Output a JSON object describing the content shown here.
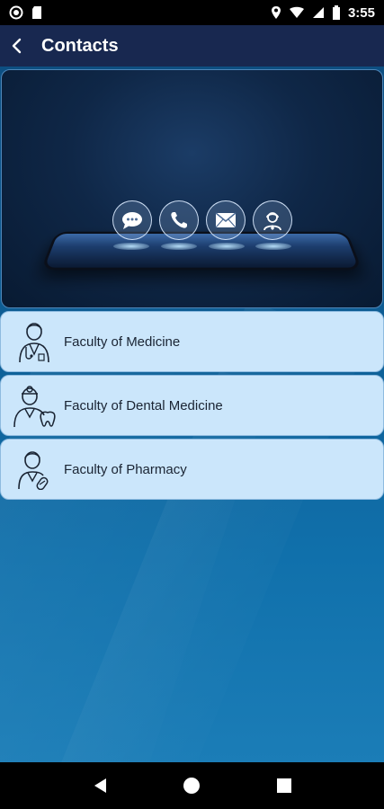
{
  "status_bar": {
    "time": "3:55",
    "icons": [
      "circle-notification-icon",
      "sd-card-icon",
      "location-icon",
      "wifi-icon",
      "signal-icon",
      "battery-icon"
    ]
  },
  "app_bar": {
    "title": "Contacts",
    "back_icon": "back-arrow-icon"
  },
  "banner": {
    "icons": [
      "chat-icon",
      "phone-icon",
      "mail-icon",
      "support-agent-icon"
    ]
  },
  "faculties": [
    {
      "label": "Faculty of Medicine",
      "icon": "doctor-icon"
    },
    {
      "label": "Faculty of Dental Medicine",
      "icon": "dentist-icon"
    },
    {
      "label": "Faculty of Pharmacy",
      "icon": "pharmacist-icon"
    }
  ],
  "nav_bar": {
    "icons": [
      "back-triangle-icon",
      "home-circle-icon",
      "recents-square-icon"
    ]
  },
  "colors": {
    "app_bar": "#182850",
    "list_item": "#cbe6fb",
    "background": "#0e5f96"
  }
}
